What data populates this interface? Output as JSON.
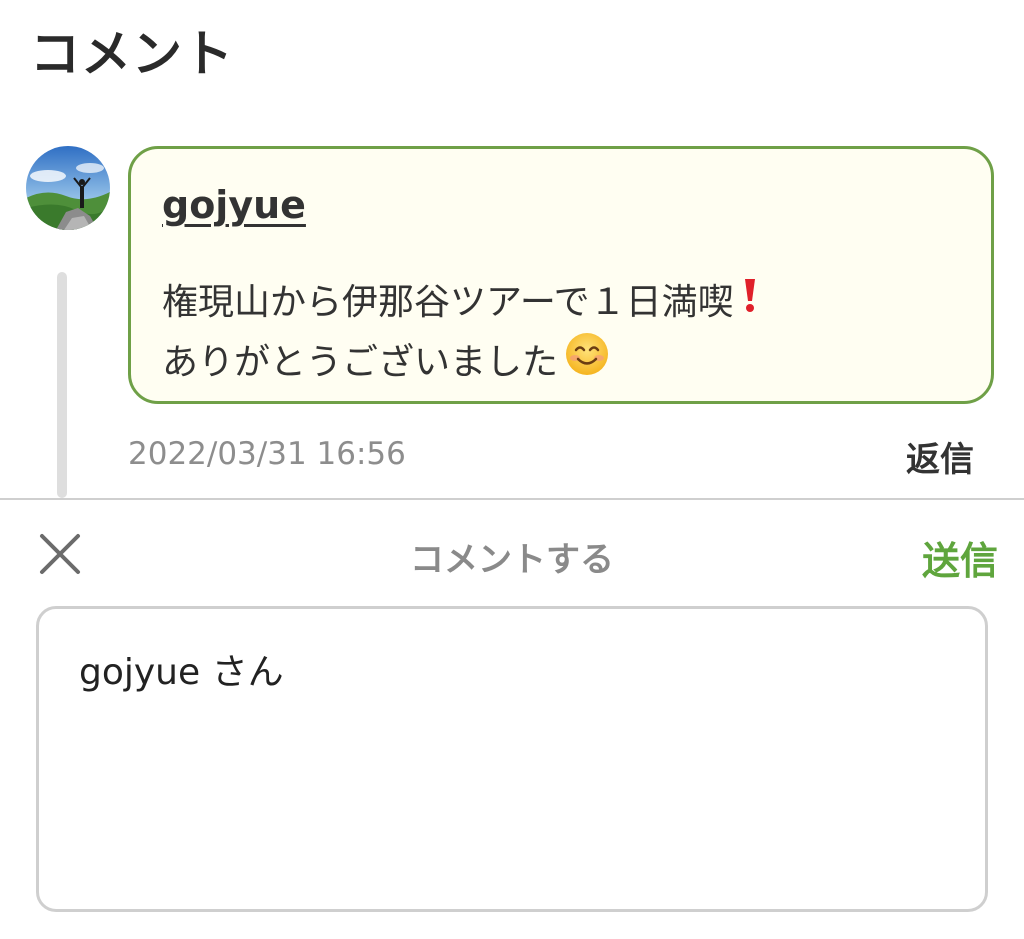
{
  "page": {
    "section_title": "コメント"
  },
  "comment": {
    "username": "gojyue",
    "text_line1": "権現山から伊那谷ツアーで１日満喫",
    "text_line2": "ありがとうございました",
    "timestamp": "2022/03/31 16:56",
    "reply_label": "返信",
    "icons": {
      "line1_end": "exclamation-mark-icon",
      "line2_end": "smiling-face-icon"
    }
  },
  "composer": {
    "title": "コメントする",
    "send_label": "送信",
    "input_value": "gojyue さん",
    "close_icon": "close-icon"
  },
  "colors": {
    "accent_green": "#5fa53d",
    "bubble_border": "#6fa047",
    "bubble_background": "#fffef2",
    "thread_line": "#dedede"
  }
}
